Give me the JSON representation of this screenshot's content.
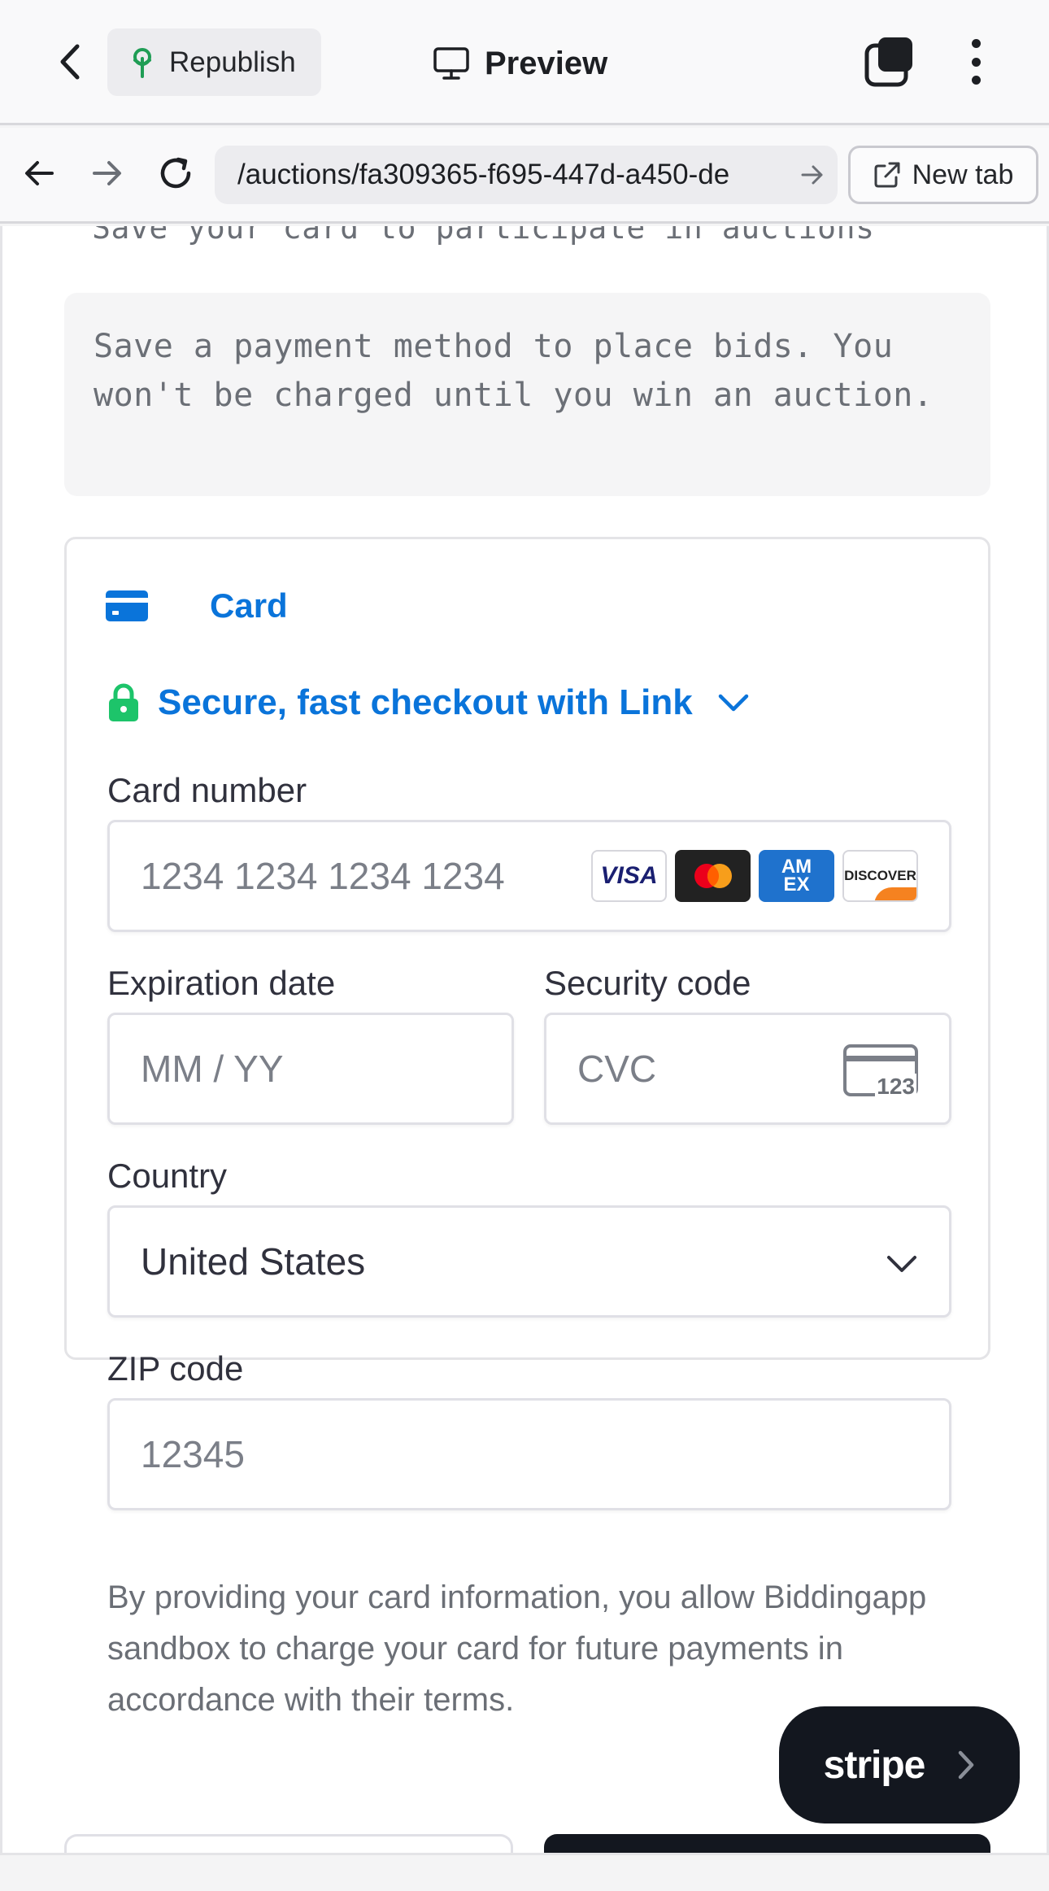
{
  "appbar": {
    "republish_label": "Republish",
    "preview_label": "Preview"
  },
  "browser": {
    "url": "/auctions/fa309365-f695-447d-a450-de",
    "newtab_label": "New tab"
  },
  "page": {
    "subheading": "Save your card to participate in auctions",
    "notice": "Save a payment method to place bids. You won't be charged until you win an auction."
  },
  "payment": {
    "tab_card_label": "Card",
    "link_label": "Secure, fast checkout with Link",
    "card_number_label": "Card number",
    "card_number_placeholder": "1234 1234 1234 1234",
    "brands": {
      "visa": "VISA",
      "amex": "AM EX",
      "discover": "DISCOVER"
    },
    "expiry_label": "Expiration date",
    "expiry_placeholder": "MM / YY",
    "cvc_label": "Security code",
    "cvc_placeholder": "CVC",
    "cvc_icon_text": "123",
    "country_label": "Country",
    "country_value": "United States",
    "zip_label": "ZIP code",
    "zip_placeholder": "12345",
    "legal_text": "By providing your card information, you allow Biddingapp sandbox to charge your card for future payments in accordance with their terms."
  },
  "stripe_badge": {
    "label": "stripe"
  },
  "colors": {
    "link_blue": "#0a74da",
    "lock_green": "#1dc46a",
    "dark": "#13171f"
  }
}
